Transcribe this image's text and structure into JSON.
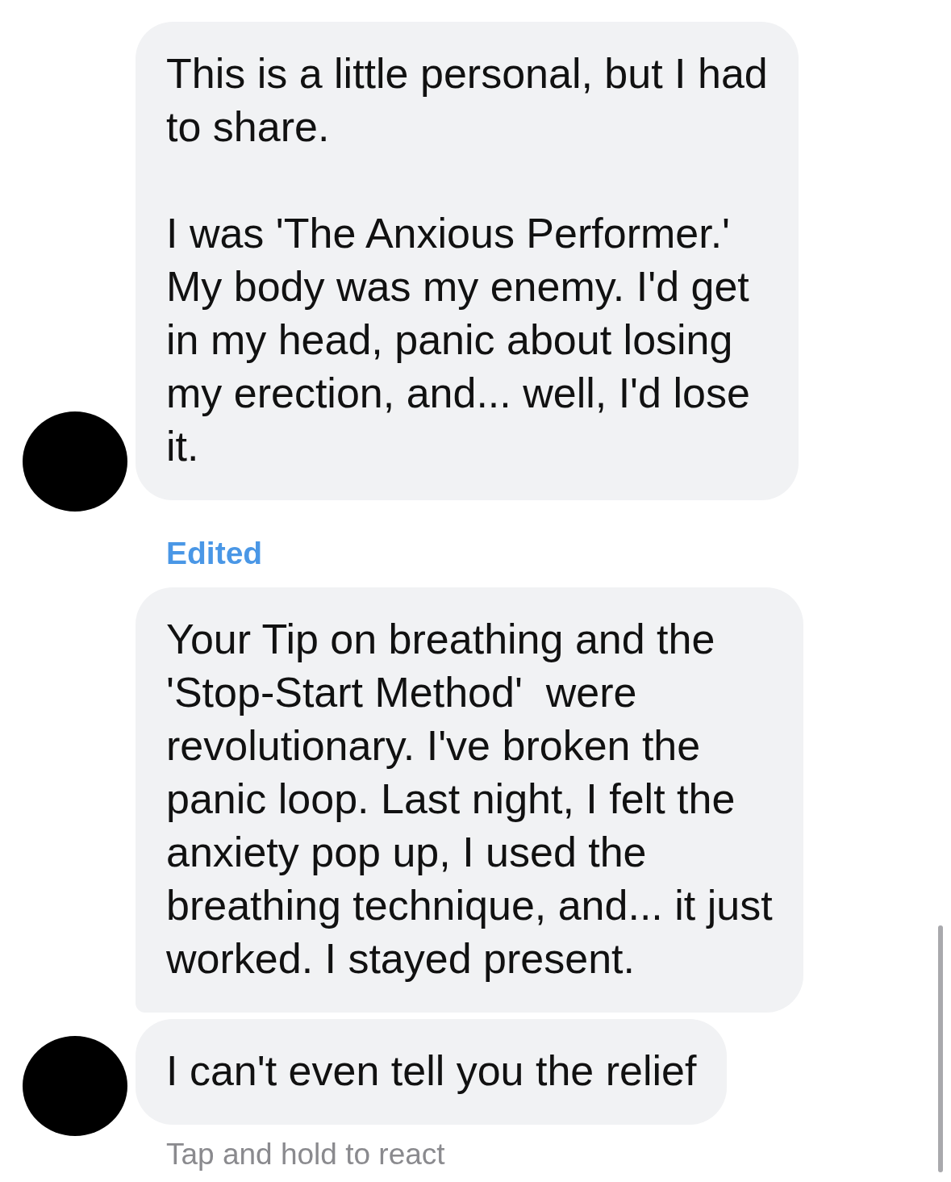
{
  "thread": [
    {
      "kind": "bubble",
      "avatar": true,
      "text": "This is a little personal, but I had\nto share.\n\nI was 'The Anxious Performer.'\nMy body was my enemy. I'd get\nin my head, panic about losing\nmy erection, and... well, I'd lose\nit."
    },
    {
      "kind": "status",
      "text": "Edited"
    },
    {
      "kind": "bubble",
      "avatar": false,
      "text": "Your Tip on breathing and the\n'Stop-Start Method'  were\nrevolutionary. I've broken the\npanic loop. Last night, I felt the\nanxiety pop up, I used the\nbreathing technique, and... it just\nworked. I stayed present."
    },
    {
      "kind": "bubble",
      "avatar": true,
      "text": "I can't even tell you the relief"
    },
    {
      "kind": "hint",
      "text": "Tap and hold to react"
    }
  ]
}
